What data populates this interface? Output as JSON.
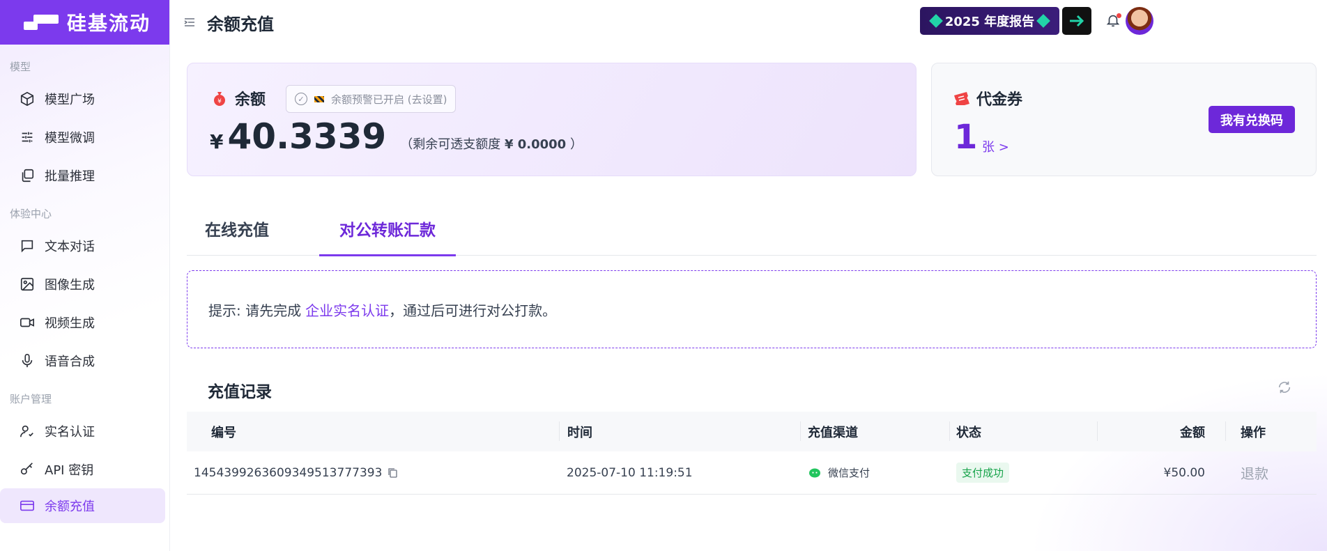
{
  "brand": {
    "name": "硅基流动",
    "color": "#7c3aed"
  },
  "header": {
    "title": "余额充值",
    "report_banner": "2025 年度报告"
  },
  "sidebar": {
    "sections": [
      {
        "label": "模型",
        "items": [
          {
            "label": "模型广场",
            "icon": "cube-icon"
          },
          {
            "label": "模型微调",
            "icon": "sliders-icon"
          },
          {
            "label": "批量推理",
            "icon": "layers-icon"
          }
        ]
      },
      {
        "label": "体验中心",
        "items": [
          {
            "label": "文本对话",
            "icon": "chat-icon"
          },
          {
            "label": "图像生成",
            "icon": "image-icon"
          },
          {
            "label": "视频生成",
            "icon": "video-icon"
          },
          {
            "label": "语音合成",
            "icon": "mic-icon"
          }
        ]
      },
      {
        "label": "账户管理",
        "items": [
          {
            "label": "实名认证",
            "icon": "user-check-icon"
          },
          {
            "label": "API 密钥",
            "icon": "key-icon"
          },
          {
            "label": "余额充值",
            "icon": "card-icon",
            "active": true
          }
        ]
      }
    ]
  },
  "balance": {
    "label": "余额",
    "alert_chip": "余额预警已开启 (去设置)",
    "currency": "¥",
    "value": "40.3339",
    "overdraft_prefix": "（剩余可透支额度",
    "overdraft_value": "¥ 0.0000",
    "overdraft_suffix": "）"
  },
  "voucher": {
    "label": "代金券",
    "count": "1",
    "unit": "张 >",
    "redeem_label": "我有兑换码"
  },
  "tabs": [
    {
      "label": "在线充值",
      "active": false
    },
    {
      "label": "对公转账汇款",
      "active": true
    }
  ],
  "notice": {
    "prefix": "提示: 请先完成",
    "link": "企业实名认证",
    "suffix": "，通过后可进行对公打款。"
  },
  "records": {
    "title": "充值记录",
    "columns": [
      "编号",
      "时间",
      "充值渠道",
      "状态",
      "金额",
      "操作"
    ],
    "rows": [
      {
        "id": "1454399263609349513777393",
        "time": "2025-07-10 11:19:51",
        "channel": "微信支付",
        "status": "支付成功",
        "amount": "¥50.00",
        "action": "退款"
      }
    ]
  },
  "colors": {
    "accent": "#7c3aed",
    "success": "#16a34a",
    "wechat": "#22c55e"
  }
}
